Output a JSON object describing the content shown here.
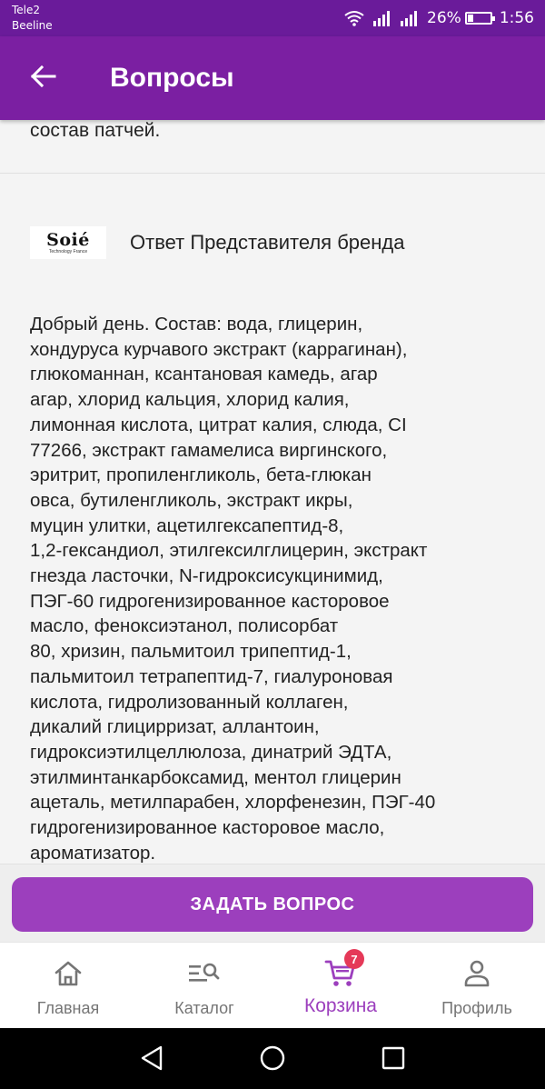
{
  "status_bar": {
    "carrier_1": "Tele2",
    "carrier_2": "Beeline",
    "battery": "26%",
    "battery_level": 0.26,
    "time": "1:56"
  },
  "app_bar": {
    "title": "Вопросы",
    "back_icon": "arrow-left-icon"
  },
  "question": {
    "text_tail": "состав патчей."
  },
  "answer": {
    "brand_logo_text": "Soié",
    "brand_logo_tagline": "Technology France",
    "label": "Ответ Представителя бренда",
    "text": "Добрый день. Состав: вода, глицерин,\nхондуруса курчавого экстракт (каррагинан),\nглюкоманнан, ксантановая камедь, агар\nагар, хлорид кальция, хлорид калия,\nлимонная кислота, цитрат калия, слюда, CI\n77266, экстракт гамамелиса виргинского,\nэритрит, пропиленгликоль, бета-глюкан\nовса, бутиленгликоль, экстракт икры,\nмуцин улитки, ацетилгексапептид-8,\n1,2-гександиол, этилгексилглицерин, экстракт\nгнезда ласточки, N-гидроксисукцинимид,\nПЭГ-60 гидрогенизированное касторовое\nмасло, феноксиэтанол, полисорбат\n80, хризин, пальмитоил трипептид-1,\nпальмитоил тетрапептид-7, гиалуроновая\nкислота, гидролизованный коллаген,\nдикалий глицирризат, аллантоин,\nгидроксиэтилцеллюлоза, динатрий ЭДТА,\nэтилминтанкарбоксамид, ментол глицерин\nацеталь, метилпарабен, хлорфенезин, ПЭГ-40\nгидрогенизированное касторовое масло,\nароматизатор."
  },
  "ask_button": {
    "label": "ЗАДАТЬ ВОПРОС"
  },
  "bottom_nav": {
    "items": [
      {
        "label": "Главная",
        "icon": "home-icon"
      },
      {
        "label": "Каталог",
        "icon": "catalog-search-icon"
      },
      {
        "label": "Корзина",
        "icon": "cart-icon",
        "badge": "7",
        "active": true
      },
      {
        "label": "Профиль",
        "icon": "profile-icon"
      }
    ]
  },
  "colors": {
    "status_bar": "#6a1b9a",
    "app_bar": "#7b1fa2",
    "accent": "#9c3fbd",
    "badge": "#e53958"
  }
}
